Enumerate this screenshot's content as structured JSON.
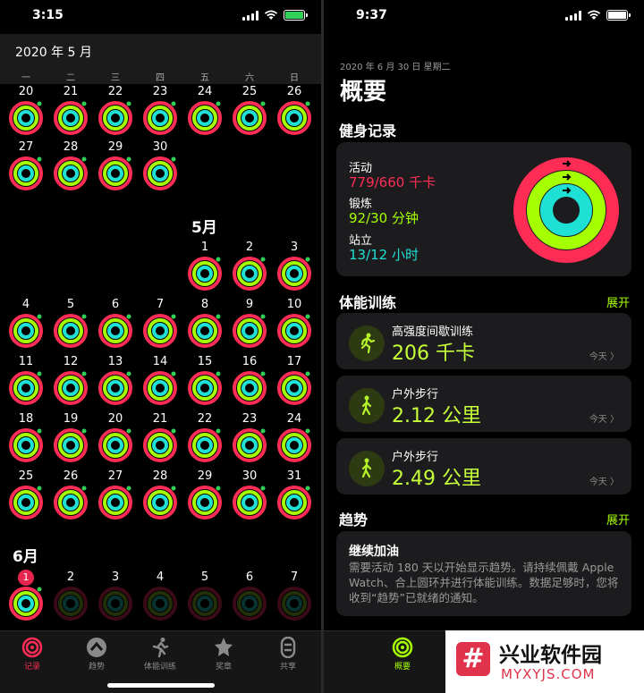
{
  "left": {
    "status_time": "3:15",
    "calendar_title": "2020 年 5 月",
    "weekdays": [
      "一",
      "二",
      "三",
      "四",
      "五",
      "六",
      "日"
    ],
    "rows_top": [
      [
        "20",
        "21",
        "22",
        "23",
        "24",
        "25",
        "26"
      ],
      [
        "27",
        "28",
        "29",
        "30"
      ]
    ],
    "may_label": "5月",
    "may_rows": [
      [
        "",
        "",
        "",
        "",
        "1",
        "2",
        "3"
      ],
      [
        "4",
        "5",
        "6",
        "7",
        "8",
        "9",
        "10"
      ],
      [
        "11",
        "12",
        "13",
        "14",
        "15",
        "16",
        "17"
      ],
      [
        "18",
        "19",
        "20",
        "21",
        "22",
        "23",
        "24"
      ],
      [
        "25",
        "26",
        "27",
        "28",
        "29",
        "30",
        "31"
      ]
    ],
    "june_label": "6月",
    "june_row": [
      "1",
      "2",
      "3",
      "4",
      "5",
      "6",
      "7"
    ],
    "tabs": [
      "记录",
      "趋势",
      "体能训练",
      "奖章",
      "共享"
    ]
  },
  "right": {
    "status_time": "9:37",
    "date": "2020 年 6 月 30 日 星期二",
    "title": "概要",
    "fitness_title": "健身记录",
    "move_label": "活动",
    "move_value": "779/660 千卡",
    "exercise_label": "锻炼",
    "exercise_value": "92/30 分钟",
    "stand_label": "站立",
    "stand_value": "13/12 小时",
    "workouts_title": "体能训练",
    "expand": "展开",
    "workouts": [
      {
        "name": "高强度间歇训练",
        "value": "206 千卡",
        "date": "今天 〉"
      },
      {
        "name": "户外步行",
        "value": "2.12 公里",
        "date": "今天 〉"
      },
      {
        "name": "户外步行",
        "value": "2.49 公里",
        "date": "今天 〉"
      }
    ],
    "trends_title": "趋势",
    "trend_card_title": "继续加油",
    "trend_card_body": "需要活动 180 天以开始显示趋势。请持续佩戴 Apple Watch、合上圆环并进行体能训练。数据足够时，您将收到“趋势”已就绪的通知。",
    "tab_summary": "概要",
    "watermark_line1": "兴业软件园",
    "watermark_line2": "MYXYJS.COM"
  },
  "colors": {
    "move": "#ff2d55",
    "exercise": "#a6ff00",
    "stand": "#1fe0d4"
  }
}
